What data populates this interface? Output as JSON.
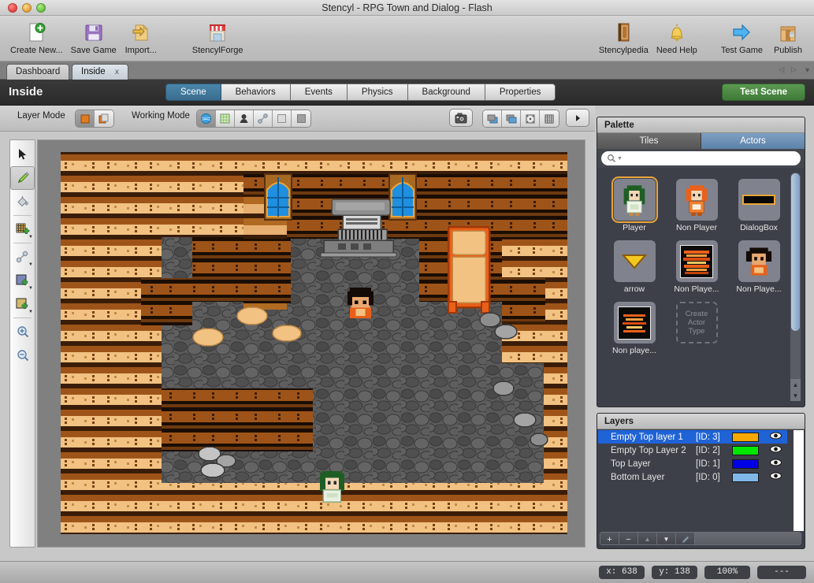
{
  "window": {
    "title": "Stencyl - RPG Town and Dialog - Flash",
    "controls": {
      "close": "close-button",
      "minimize": "minimize-button",
      "maximize": "maximize-button"
    }
  },
  "toolbar": {
    "left_items": [
      {
        "label": "Create New...",
        "icon": "new-document-icon"
      },
      {
        "label": "Save Game",
        "icon": "floppy-disk-icon"
      },
      {
        "label": "Import...",
        "icon": "import-folder-icon"
      },
      {
        "label": "StencylForge",
        "icon": "storefront-icon"
      }
    ],
    "right_items": [
      {
        "label": "Stencylpedia",
        "icon": "book-icon"
      },
      {
        "label": "Need Help",
        "icon": "bell-icon"
      },
      {
        "label": "Test Game",
        "icon": "blue-arrow-icon"
      },
      {
        "label": "Publish",
        "icon": "package-box-icon"
      }
    ]
  },
  "tabs": {
    "items": [
      {
        "label": "Dashboard",
        "active": false,
        "closable": false
      },
      {
        "label": "Inside",
        "active": true,
        "closable": true,
        "close_glyph": "x"
      }
    ],
    "nav": {
      "prev": "◁",
      "next": "▷",
      "list": "▼"
    }
  },
  "scene_header": {
    "name": "Inside",
    "mode_tabs": [
      {
        "label": "Scene",
        "selected": true
      },
      {
        "label": "Behaviors",
        "selected": false
      },
      {
        "label": "Events",
        "selected": false
      },
      {
        "label": "Physics",
        "selected": false
      },
      {
        "label": "Background",
        "selected": false
      },
      {
        "label": "Properties",
        "selected": false
      }
    ],
    "test_button": "Test Scene"
  },
  "editor_bar": {
    "layer_mode_label": "Layer Mode",
    "layer_mode_buttons": [
      {
        "name": "single-layer-mode",
        "selected": true
      },
      {
        "name": "all-layers-mode",
        "selected": false
      }
    ],
    "working_mode_label": "Working Mode",
    "working_mode_buttons": [
      {
        "name": "terrain-mode",
        "selected": true
      },
      {
        "name": "tile-mode",
        "selected": false
      },
      {
        "name": "actor-mode",
        "selected": false
      },
      {
        "name": "joint-mode",
        "selected": false
      },
      {
        "name": "region-mode",
        "selected": false
      },
      {
        "name": "shape-mode",
        "selected": false
      }
    ],
    "right_buttons": [
      {
        "name": "snapshot-camera-button"
      },
      {
        "name": "send-backward-button"
      },
      {
        "name": "bring-forward-button"
      },
      {
        "name": "snap-to-grid-button"
      },
      {
        "name": "toggle-grid-button"
      },
      {
        "name": "expand-panel-button"
      }
    ]
  },
  "tool_palette": {
    "tools": [
      {
        "name": "select-tool",
        "icon": "cursor-arrow-icon",
        "selected": false,
        "has_caret": false
      },
      {
        "name": "pencil-tool",
        "icon": "pencil-icon",
        "selected": true,
        "has_caret": false
      },
      {
        "name": "fill-tool",
        "icon": "paint-bucket-icon",
        "selected": false,
        "has_caret": false
      },
      {
        "name": "tile-brush-tool",
        "icon": "grid-stamp-icon",
        "selected": false,
        "has_caret": true
      },
      {
        "name": "joint-tool",
        "icon": "joint-link-icon",
        "selected": false,
        "has_caret": true
      },
      {
        "name": "region-tool",
        "icon": "blue-region-icon",
        "selected": false,
        "has_caret": true
      },
      {
        "name": "terrain-tool",
        "icon": "tan-region-icon",
        "selected": false,
        "has_caret": true
      },
      {
        "name": "zoom-in-tool",
        "icon": "magnifier-plus-icon",
        "selected": false,
        "has_caret": false
      },
      {
        "name": "zoom-out-tool",
        "icon": "magnifier-minus-icon",
        "selected": false,
        "has_caret": false
      }
    ]
  },
  "palette": {
    "title": "Palette",
    "tabs": [
      {
        "label": "Tiles",
        "selected": false
      },
      {
        "label": "Actors",
        "selected": true
      }
    ],
    "search": {
      "placeholder": "",
      "value": "",
      "icon": "search-icon"
    },
    "actors": [
      {
        "label": "Player",
        "icon": "green-haired-girl-sprite",
        "selected": true
      },
      {
        "label": "Non Player",
        "icon": "orange-haired-kid-sprite",
        "selected": false
      },
      {
        "label": "DialogBox",
        "icon": "black-dialog-bar-sprite",
        "selected": false
      },
      {
        "label": "arrow",
        "icon": "yellow-down-triangle-sprite",
        "selected": false
      },
      {
        "label": "Non Playe...",
        "icon": "orange-stripe-sprite",
        "selected": false
      },
      {
        "label": "Non Playe...",
        "icon": "dark-haired-boy-sprite",
        "selected": false
      },
      {
        "label": "Non playe...",
        "icon": "orange-stripe-dark-sprite",
        "selected": false
      }
    ],
    "create_actor_label": "Create Actor Type",
    "create_actor_lines": [
      "Create",
      "Actor",
      "Type"
    ]
  },
  "layers": {
    "title": "Layers",
    "columns": [
      "name",
      "id",
      "color",
      "visible"
    ],
    "rows": [
      {
        "name": "Empty Top layer 1",
        "id": "[ID: 3]",
        "color": "#f5a800",
        "visible": true,
        "selected": true
      },
      {
        "name": "Empty Top Layer 2",
        "id": "[ID: 2]",
        "color": "#00e800",
        "visible": true,
        "selected": false
      },
      {
        "name": "Top Layer",
        "id": "[ID: 1]",
        "color": "#0000e8",
        "visible": true,
        "selected": false
      },
      {
        "name": "Bottom Layer",
        "id": "[ID: 0]",
        "color": "#7fb8e8",
        "visible": true,
        "selected": false
      }
    ],
    "buttons": [
      {
        "name": "add-layer-button",
        "glyph": "+"
      },
      {
        "name": "remove-layer-button",
        "glyph": "−"
      },
      {
        "name": "move-layer-up-button",
        "glyph": "▲"
      },
      {
        "name": "move-layer-down-button",
        "glyph": "▼"
      },
      {
        "name": "edit-layer-button",
        "glyph": "✎"
      }
    ]
  },
  "status_bar": {
    "fields": [
      {
        "name": "cursor-x",
        "value": "x: 638"
      },
      {
        "name": "cursor-y",
        "value": "y: 138"
      },
      {
        "name": "zoom-level",
        "value": "100%"
      },
      {
        "name": "tile-info",
        "value": "---"
      }
    ]
  },
  "scene": {
    "description": "RPG interior tilemap: wooden plank floor border, dark stone floor interior, blue stained-glass windows, an organ/piano, an orange bed, scattered rocks, player sprite in center and a green-haired character at bottom",
    "colors": {
      "plank_light": "#f2c282",
      "plank_dark": "#8a4a14",
      "stone_dark": "#4f4f4f",
      "stone_mid": "#6e6e6e",
      "window_blue": "#1f8fe0",
      "bed_orange": "#e8601a",
      "canvas_bg": "#808080"
    }
  }
}
